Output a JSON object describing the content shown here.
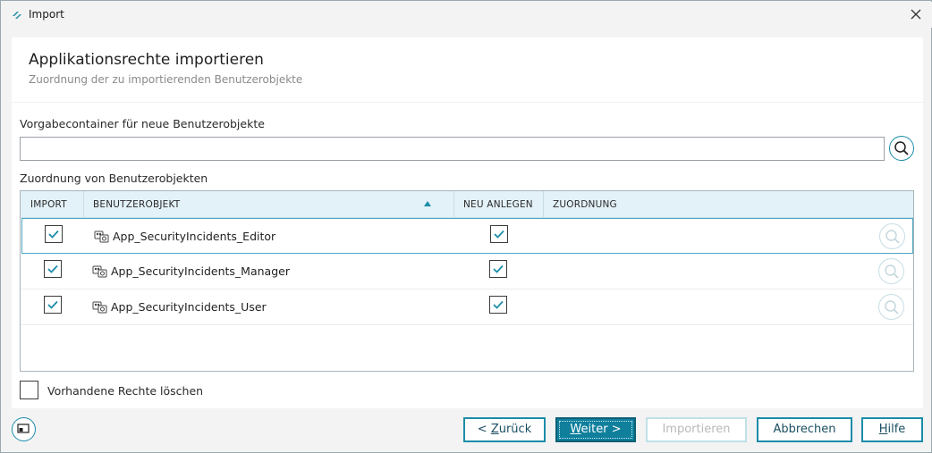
{
  "window": {
    "title": "Import",
    "close_icon": "close-icon"
  },
  "header": {
    "title": "Applikationsrechte importieren",
    "subtitle": "Zuordnung der zu importierenden Benutzerobjekte"
  },
  "container": {
    "label": "Vorgabecontainer für neue Benutzerobjekte",
    "value": "",
    "placeholder": ""
  },
  "mapping": {
    "label": "Zuordnung von Benutzerobjekten",
    "columns": {
      "import": "IMPORT",
      "object": "BENUTZEROBJEKT",
      "create": "NEU ANLEGEN",
      "assignment": "ZUORDNUNG"
    },
    "rows": [
      {
        "name": "App_SecurityIncidents_Editor",
        "import": true,
        "create": true,
        "assignment": ""
      },
      {
        "name": "App_SecurityIncidents_Manager",
        "import": true,
        "create": true,
        "assignment": ""
      },
      {
        "name": "App_SecurityIncidents_User",
        "import": true,
        "create": true,
        "assignment": ""
      }
    ]
  },
  "delete_rights": {
    "label": "Vorhandene Rechte löschen",
    "checked": false
  },
  "buttons": {
    "back_pre": "< ",
    "back_u": "Z",
    "back_post": "urück",
    "next_u": "W",
    "next_post": "eiter >",
    "import": "Importieren",
    "cancel": "Abbrechen",
    "help_u": "H",
    "help_post": "ilfe"
  },
  "colors": {
    "accent": "#1a8ca8",
    "header_bg": "#e3f1f8",
    "primary_button": "#0f7f9c"
  }
}
